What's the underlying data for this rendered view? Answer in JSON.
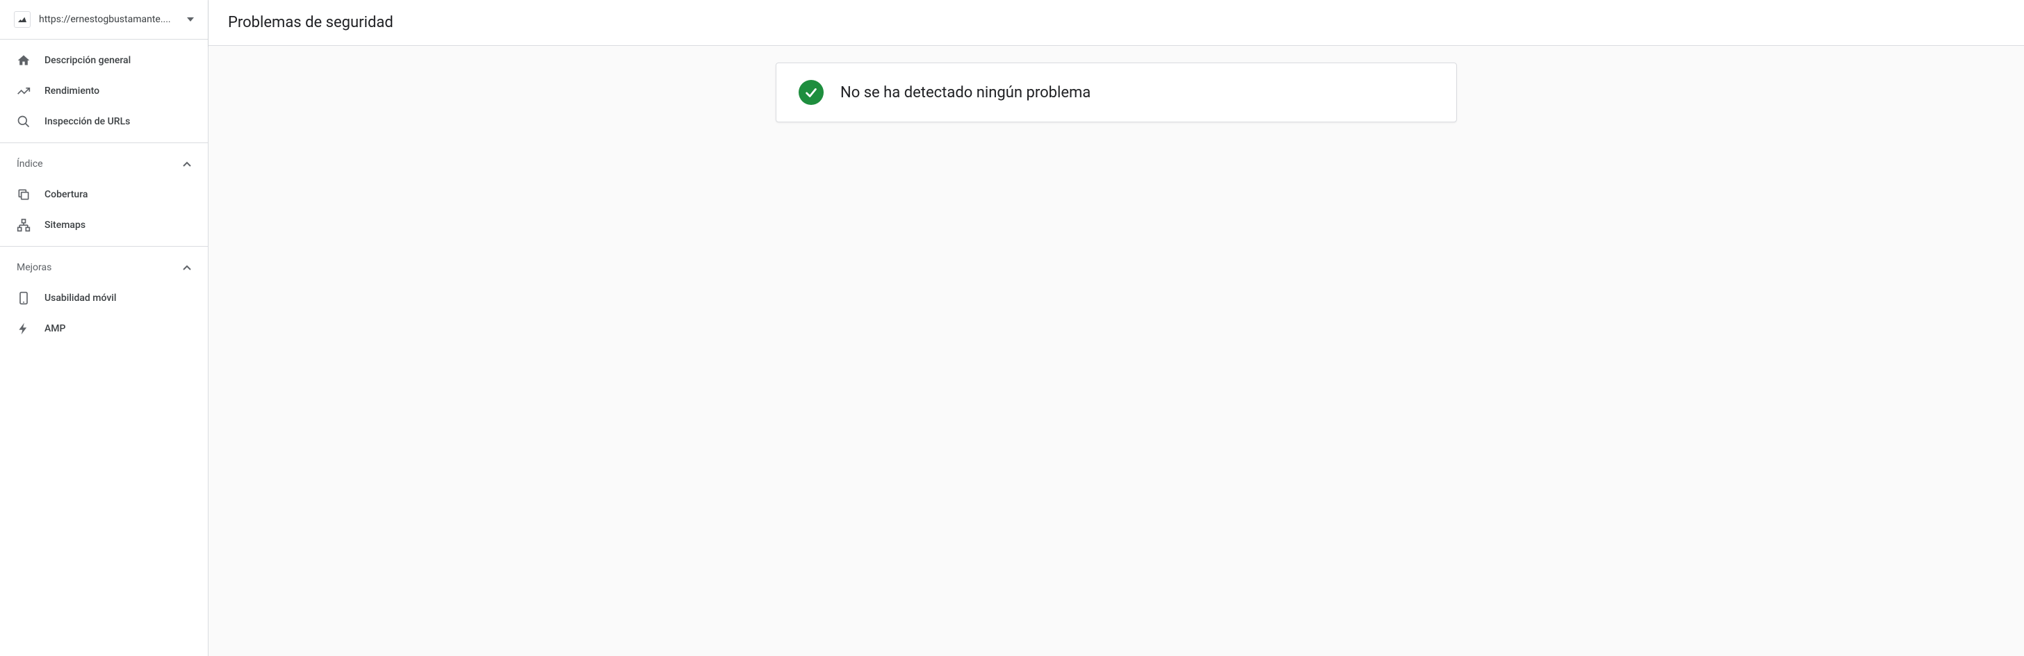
{
  "property": {
    "url": "https://ernestogbustamante...."
  },
  "sidebar": {
    "main_nav": [
      {
        "label": "Descripción general"
      },
      {
        "label": "Rendimiento"
      },
      {
        "label": "Inspección de URLs"
      }
    ],
    "sections": [
      {
        "title": "Índice",
        "items": [
          {
            "label": "Cobertura"
          },
          {
            "label": "Sitemaps"
          }
        ]
      },
      {
        "title": "Mejoras",
        "items": [
          {
            "label": "Usabilidad móvil"
          },
          {
            "label": "AMP"
          }
        ]
      }
    ]
  },
  "page": {
    "title": "Problemas de seguridad"
  },
  "status": {
    "message": "No se ha detectado ningún problema",
    "color": "#1e8e3e"
  }
}
